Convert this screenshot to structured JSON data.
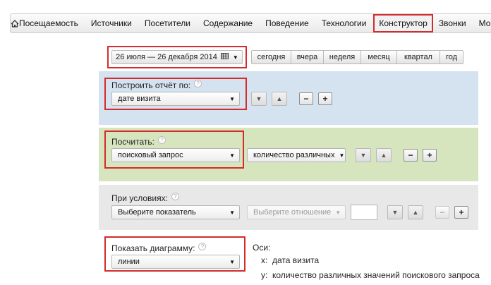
{
  "nav": {
    "items": [
      "Посещаемость",
      "Источники",
      "Посетители",
      "Содержание",
      "Поведение",
      "Технологии",
      "Конструктор",
      "Звонки",
      "Мо"
    ],
    "active": "Конструктор"
  },
  "date_range": {
    "value": "26 июля — 26 декабря 2014",
    "periods": [
      "сегодня",
      "вчера",
      "неделя",
      "месяц",
      "квартал",
      "год"
    ]
  },
  "build_report": {
    "label": "Построить отчёт по:",
    "help": "?",
    "select": "дате визита",
    "minus": "−",
    "plus": "+"
  },
  "calculate": {
    "label": "Посчитать:",
    "help": "?",
    "select": "поисковый запрос",
    "metric": "количество различных",
    "minus": "−",
    "plus": "+"
  },
  "conditions": {
    "label": "При условиях:",
    "help": "?",
    "indicator_placeholder": "Выберите показатель",
    "relation_placeholder": "Выберите отношение",
    "value": "",
    "minus": "−",
    "plus": "+"
  },
  "diagram": {
    "label": "Показать диаграмму:",
    "help": "?",
    "select": "линии",
    "axes_label": "Оси:",
    "x_prefix": "x:",
    "x_value": "дата визита",
    "y_prefix": "y:",
    "y_value": "количество различных значений поискового запроса"
  },
  "colors": {
    "highlight": "#d52b2b",
    "blue_section": "#d4e3ef",
    "green_section": "#d6e5be",
    "gray_section": "#e8e8e8"
  }
}
